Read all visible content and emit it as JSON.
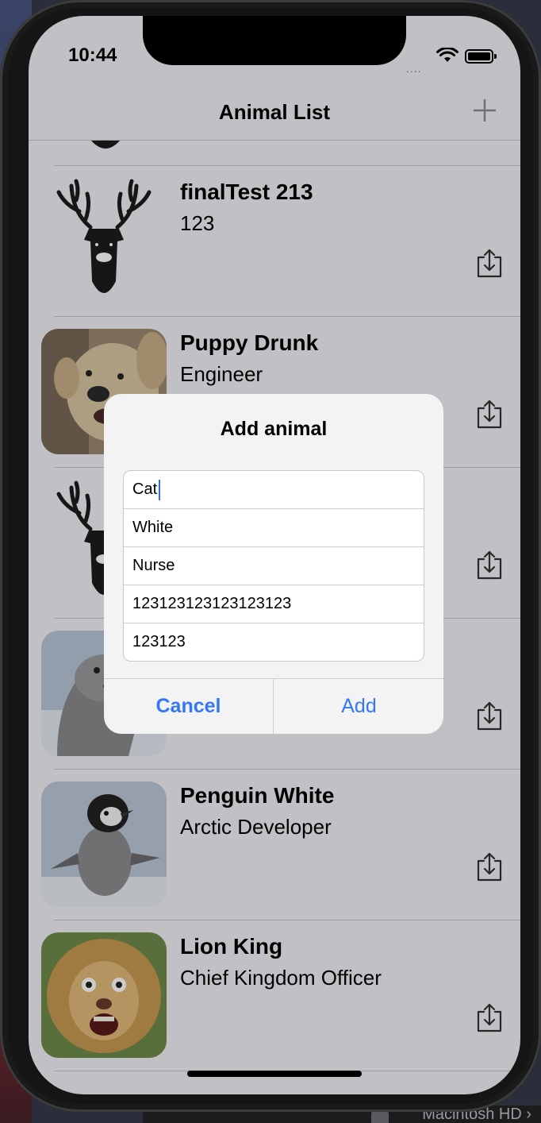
{
  "status_bar": {
    "time": "10:44"
  },
  "navbar": {
    "title": "Animal List",
    "add_icon": "plus-icon"
  },
  "animals": [
    {
      "name": "finalTest 213",
      "subtitle": "123",
      "image": "deer-silhouette"
    },
    {
      "name": "Puppy Drunk",
      "subtitle": "Engineer",
      "image": "dog-photo"
    },
    {
      "name": "",
      "subtitle": "",
      "image": "deer-silhouette"
    },
    {
      "name": "",
      "subtitle": "",
      "image": "seal-photo"
    },
    {
      "name": "Penguin White",
      "subtitle": "Arctic Developer",
      "image": "penguin-photo"
    },
    {
      "name": "Lion King",
      "subtitle": "Chief Kingdom Officer",
      "image": "lion-photo"
    }
  ],
  "alert": {
    "title": "Add animal",
    "fields": [
      "Cat",
      "White",
      "Nurse",
      "123123123123123123",
      "123123"
    ],
    "cancel_label": "Cancel",
    "add_label": "Add"
  },
  "desktop": {
    "disk_label": "Macintosh HD ›"
  },
  "colors": {
    "tint": "#3478f6",
    "caret": "#2f6fde"
  }
}
